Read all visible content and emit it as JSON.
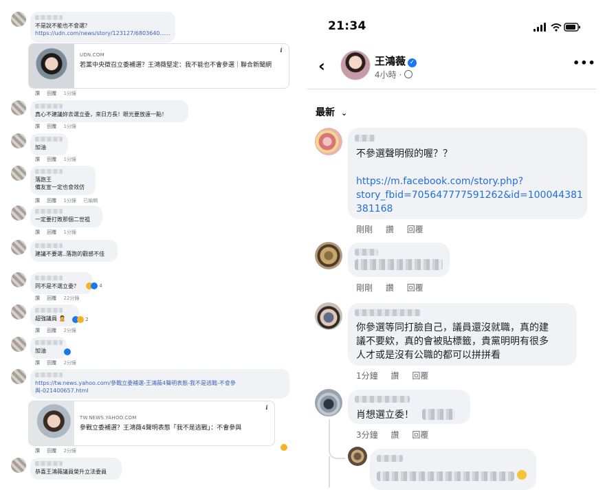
{
  "left": {
    "comments": [
      {
        "text": "不是說不能也不會選？",
        "link": "https://udn.com/news/story/123127/6803640......"
      },
      {
        "text": "真心不建議妳去選立委，來日方長！眼光要放遠一點！",
        "time": "1分鐘"
      },
      {
        "text": "加油",
        "time": "1分鐘"
      },
      {
        "lines": [
          "落跑王",
          "備友宣一定也會效仿"
        ],
        "time": "1分鐘",
        "edited": "已編輯"
      },
      {
        "text": "一定要打敗那個二世祖",
        "time": "1分鐘"
      },
      {
        "text": "建議不要選..落跑的觀感不佳"
      },
      {
        "text": "同不是不選立委？",
        "time": "22分鐘",
        "reactions": "4"
      },
      {
        "text": "超強議員 🙎",
        "time": "2分鐘",
        "reactions": "2"
      },
      {
        "text": "加油",
        "time": "2分鐘"
      },
      {
        "link": "https://tw.news.yahoo.com/參戰立委補選-王鴻薇4聲明表態-我不是逃戰-不會參與-021400657.html",
        "time": "2分鐘"
      },
      {
        "text": "恭喜王鴻薇議員榮升立法委員"
      }
    ],
    "actions": {
      "like": "讚",
      "reply": "回覆"
    },
    "first_time": "1分鐘",
    "cards": [
      {
        "source": "UDN.COM",
        "title": "若黨中央徵召立委補選？王鴻薇堅定：我不能也不會參選｜聯合新聞網"
      },
      {
        "source": "TW.NEWS.YAHOO.COM",
        "title": "參戰立委補選？王鴻薇4聲明表態「我不是逃戰」：不會參與"
      }
    ],
    "info_glyph": "i"
  },
  "right": {
    "status": {
      "time": "21:34"
    },
    "header": {
      "name": "王鴻薇",
      "time": "4小時 ·",
      "more": "•••",
      "back": "‹"
    },
    "sort_label": "最新",
    "comments": [
      {
        "text": "不參選聲明假的喔？？",
        "link": "https://m.facebook.com/story.php?\nstory_fbid=705647777591262&id=100044381\n381168",
        "time": "剛剛"
      },
      {
        "time": "剛剛"
      },
      {
        "text": "你參選等同打臉自己，議員還沒就職，真的建\n議不要欸，真的會被貼標籤，貴黨明明有很多\n人才或是沒有公職的都可以拼拼看",
        "time": "1分鐘"
      },
      {
        "text": "肖想選立委！",
        "time": "3分鐘"
      }
    ],
    "actions": {
      "like": "讚",
      "reply": "回覆"
    }
  },
  "colors": {
    "bubble": "#f0f2f5",
    "link": "#216fdb",
    "verified": "#1877f2",
    "meta": "#65676b"
  }
}
